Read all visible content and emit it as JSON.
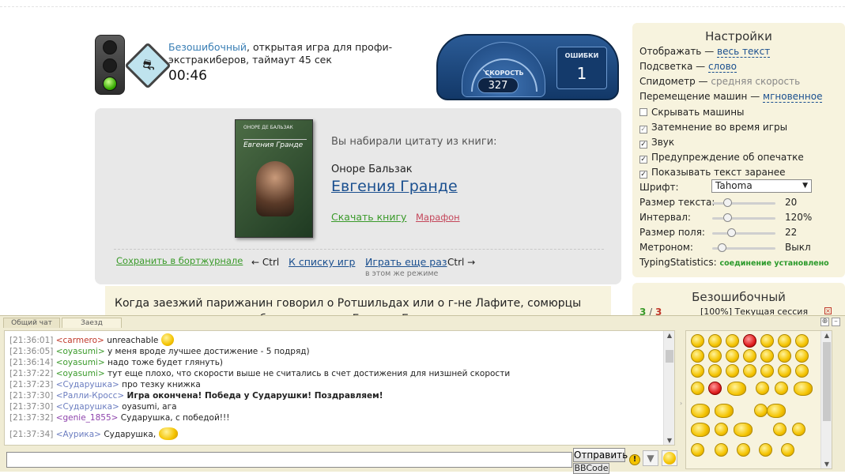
{
  "header": {
    "mode_name": "Безошибочный",
    "mode_desc": ", открытая игра для профи-экстракиберов, таймаут 45 сек",
    "timer": "00:46",
    "speed_label": "СКОРОСТЬ",
    "speed_value": "327",
    "errors_label": "ОШИБКИ",
    "errors_value": "1"
  },
  "book": {
    "cover_author": "ОНОРЕ ДЕ БАЛЬЗАК",
    "cover_title": "Евгения Гранде",
    "caption": "Вы набирали цитату из книги:",
    "author": "Оноре Бальзак",
    "title": "Евгения Гранде",
    "download": "Скачать книгу",
    "marathon": "Марафон",
    "save_link": "Сохранить в бортжурнале",
    "ctrl_left": "← Ctrl",
    "list_link": "К списку игр",
    "again_link": "Играть еще раз",
    "ctrl_right": "Ctrl →",
    "again_sub": "в этом же режиме"
  },
  "text": {
    "body": "Когда заезжий парижанин говорил о Ротшильдах или о г-не Лафите, сомюрцы спрашивали, так ли они богаты, как г-н Гранде. Если парижанин с"
  },
  "settings": {
    "title": "Настройки",
    "display_label": "Отображать —",
    "display_value": "весь текст",
    "highlight_label": "Подсветка —",
    "highlight_value": "слово",
    "speedo_label": "Спидометр —",
    "speedo_value": "средняя скорость",
    "move_label": "Перемещение машин —",
    "move_value": "мгновенное",
    "checkboxes": [
      {
        "label": "Скрывать машины",
        "checked": false
      },
      {
        "label": "Затемнение во время игры",
        "checked": true
      },
      {
        "label": "Звук",
        "checked": true
      },
      {
        "label": "Предупреждение об опечатке",
        "checked": true
      },
      {
        "label": "Показывать текст заранее",
        "checked": true
      }
    ],
    "font_label": "Шрифт:",
    "font_value": "Tahoma",
    "sliders": [
      {
        "label": "Размер текста:",
        "value": "20",
        "level": 0.2
      },
      {
        "label": "Интервал:",
        "value": "120%",
        "level": 0.2
      },
      {
        "label": "Размер поля:",
        "value": "22",
        "level": 0.28
      },
      {
        "label": "Метроном:",
        "value": "Выкл",
        "level": 0.1
      }
    ],
    "ts_label": "TypingStatistics:",
    "ts_status": "соединение установлено"
  },
  "mode_box": {
    "title": "Безошибочный",
    "score_a": "3",
    "score_sep": " / ",
    "score_b": "3",
    "session": "[100%] Текущая сессия"
  },
  "chat": {
    "tab_general": "Общий чат",
    "tab_race": "Заезд",
    "messages": [
      {
        "ts": "[21:36:01]",
        "user": "<carmero>",
        "text": "unreachable"
      },
      {
        "ts": "[21:36:05]",
        "user": "<oyasumi>",
        "text": "у меня вроде лучшее достижение - 5 подряд)"
      },
      {
        "ts": "[21:36:14]",
        "user": "<oyasumi>",
        "text": "надо тоже будет глянуть)"
      },
      {
        "ts": "[21:37:22]",
        "user": "<oyasumi>",
        "text": "тут еще плохо, что скорости выше не считались в счет достижения для низшней скорости"
      },
      {
        "ts": "[21:37:23]",
        "user": "<Сударушка>",
        "text": "про тезку книжка"
      },
      {
        "ts": "[21:37:30]",
        "user": "<Ралли-Кросс>",
        "text": "Игра окончена! Победа у Сударушки! Поздравляем!"
      },
      {
        "ts": "[21:37:30]",
        "user": "<Сударушка>",
        "text": "oyasumi, ага"
      },
      {
        "ts": "[21:37:32]",
        "user": "<genie_1855>",
        "text": "Сударушка, с победой!!!"
      },
      {
        "ts": "[21:37:34]",
        "user": "<Аурика>",
        "text": "Сударушка,"
      }
    ],
    "send_label": "Отправить",
    "bbcode_label": "BBCode"
  },
  "colors": {
    "panel_bg": "#e8e8e8",
    "settings_bg": "#f7f3de",
    "link_blue": "#1a4f8f",
    "link_green": "#3a9a2a",
    "dial_blue": "#1a447a"
  }
}
